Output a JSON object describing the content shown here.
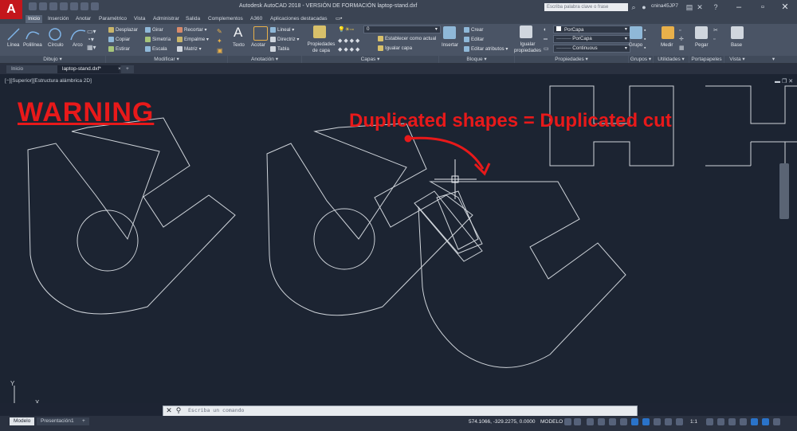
{
  "app": {
    "logo_letter": "A",
    "title": "Autodesk AutoCAD 2018 - VERSIÓN DE FORMACIÓN      laptop-stand.dxf",
    "search_placeholder": "Escriba palabra clave o frase",
    "user": "cnina45JP7"
  },
  "ribbon_tabs": [
    "Inicio",
    "Inserción",
    "Anotar",
    "Paramétrico",
    "Vista",
    "Administrar",
    "Salida",
    "Complementos",
    "A360",
    "Aplicaciones destacadas"
  ],
  "panels": {
    "dibujo": {
      "title": "Dibujo ▾",
      "buttons": [
        "Línea",
        "Polilínea",
        "Círculo",
        "Arco"
      ]
    },
    "modificar": {
      "title": "Modificar ▾",
      "buttons": [
        "Desplazar",
        "Girar",
        "Recortar",
        "Copiar",
        "Simetría",
        "Empalme",
        "Estirar",
        "Escala",
        "Matriz"
      ]
    },
    "anotacion": {
      "title": "Anotación ▾",
      "buttons": [
        "Texto",
        "Acotar",
        "Lineal",
        "Directriz",
        "Tabla"
      ]
    },
    "capas": {
      "title": "Capas ▾",
      "props_button": "Propiedades de capa",
      "layer_value": "0",
      "set_current": "Establecer como actual",
      "match_layer": "Igualar capa"
    },
    "bloque": {
      "title": "Bloque ▾",
      "insert": "Insertar",
      "create": "Crear",
      "edit": "Editar",
      "edit_attrs": "Editar atributos"
    },
    "propiedades": {
      "title": "Propiedades ▾",
      "match": "Igualar propiedades",
      "color": "PorCapa",
      "lineweight": "PorCapa",
      "linetype": "Continuous"
    },
    "grupos": {
      "title": "Grupos ▾",
      "button": "Grupo"
    },
    "utilidades": {
      "title": "Utilidades ▾",
      "button": "Medir"
    },
    "portapapeles": {
      "title": "Portapapeles",
      "button": "Pegar"
    },
    "vista": {
      "title": "Vista ▾",
      "button": "Base"
    }
  },
  "doc_tabs": [
    "Inicio",
    "laptop-stand.dxf*"
  ],
  "viewport_label": "[−][Superior][Estructura alámbrica 2D]",
  "annotations": {
    "warning": "WARNING",
    "message": "Duplicated shapes = Duplicated cut"
  },
  "command_prompt": "Escriba un comando",
  "layout_tabs": [
    "Modelo",
    "Presentación1"
  ],
  "status": {
    "coords": "574.1066, -329.2275, 0.0000",
    "mode": "MODELO",
    "scale": "1:1"
  },
  "colors": {
    "accent": "#e8191a",
    "canvas": "#1c2432",
    "logo": "#c4161c"
  }
}
